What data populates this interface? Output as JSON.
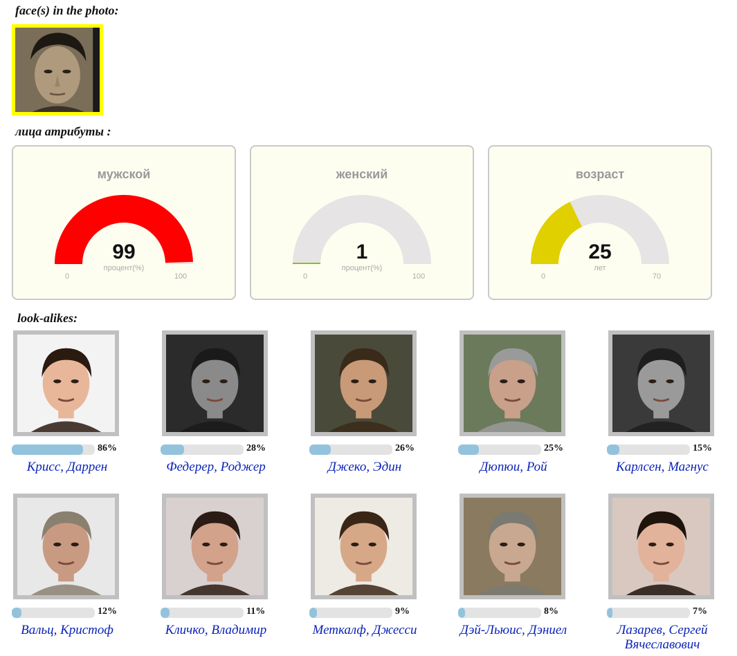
{
  "headings": {
    "faces": "face(s) in the photo:",
    "attributes": "лица атрибуты :",
    "lookalikes": "look-alikes:"
  },
  "gauges": [
    {
      "title": "мужской",
      "value": 99,
      "unit": "процент(%)",
      "min": 0,
      "max": 100,
      "color": "#ff0000"
    },
    {
      "title": "женский",
      "value": 1,
      "unit": "процент(%)",
      "min": 0,
      "max": 100,
      "color": "#8cbf1f"
    },
    {
      "title": "возраст",
      "value": 25,
      "unit": "лет",
      "min": 0,
      "max": 70,
      "color": "#e0d000"
    }
  ],
  "lookalikes": [
    {
      "name": "Крисс, Даррен",
      "percent": 86,
      "percent_label": "86%",
      "bg": "#f3f3f3",
      "skin": "#e8b79a",
      "hair": "#2a1a10"
    },
    {
      "name": "Федерер, Роджер",
      "percent": 28,
      "percent_label": "28%",
      "bg": "#2b2b2b",
      "skin": "#8a8a8a",
      "hair": "#1a1a1a"
    },
    {
      "name": "Джеко, Эдин",
      "percent": 26,
      "percent_label": "26%",
      "bg": "#4a4a3a",
      "skin": "#c99a78",
      "hair": "#3a2a1a"
    },
    {
      "name": "Дюпюи, Рой",
      "percent": 25,
      "percent_label": "25%",
      "bg": "#6b7a5a",
      "skin": "#c9a08a",
      "hair": "#9a9a9a"
    },
    {
      "name": "Карлсен, Магнус",
      "percent": 15,
      "percent_label": "15%",
      "bg": "#3a3a3a",
      "skin": "#9a9a9a",
      "hair": "#1e1e1e"
    },
    {
      "name": "Вальц, Кристоф",
      "percent": 12,
      "percent_label": "12%",
      "bg": "#e8e8e8",
      "skin": "#c99a82",
      "hair": "#8a8070"
    },
    {
      "name": "Кличко, Владимир",
      "percent": 11,
      "percent_label": "11%",
      "bg": "#d9d0d0",
      "skin": "#d2a28a",
      "hair": "#2a1c14"
    },
    {
      "name": "Меткалф, Джесси",
      "percent": 9,
      "percent_label": "9%",
      "bg": "#eeeae4",
      "skin": "#d6a888",
      "hair": "#3a2616"
    },
    {
      "name": "Дэй-Льюис, Дэниел",
      "percent": 8,
      "percent_label": "8%",
      "bg": "#8a7a60",
      "skin": "#c8a890",
      "hair": "#7a7a72"
    },
    {
      "name": "Лазарев, Сергей Вячеславович",
      "percent": 7,
      "percent_label": "7%",
      "bg": "#d8c8c0",
      "skin": "#e2b29a",
      "hair": "#1e140c"
    }
  ]
}
